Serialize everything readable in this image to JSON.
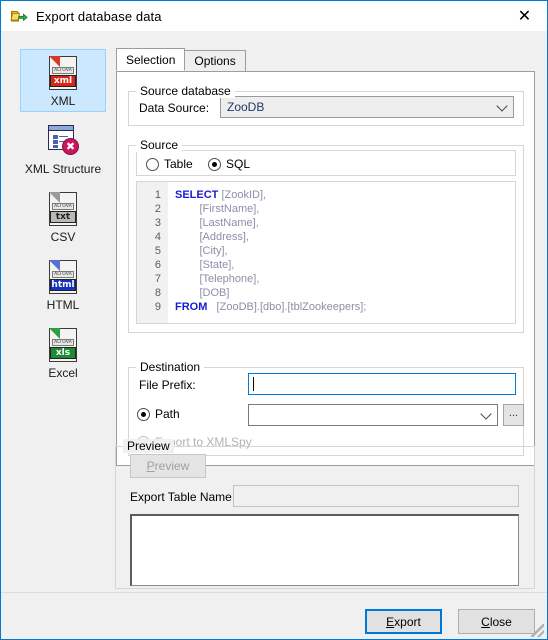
{
  "window": {
    "title": "Export database data",
    "icon": "export-database-icon",
    "close_label": "✕",
    "accent": "#0078d7"
  },
  "sidebar": {
    "items": [
      {
        "label": "XML",
        "icon": "xml-file-icon",
        "badge": "xml",
        "selected": true
      },
      {
        "label": "XML Structure",
        "icon": "xml-structure-icon",
        "badge": "",
        "selected": false
      },
      {
        "label": "CSV",
        "icon": "txt-file-icon",
        "badge": "txt",
        "selected": false
      },
      {
        "label": "HTML",
        "icon": "html-file-icon",
        "badge": "html",
        "selected": false
      },
      {
        "label": "Excel",
        "icon": "xls-file-icon",
        "badge": "xls",
        "selected": false
      }
    ],
    "brand_mark": "ALTOVA"
  },
  "tabs": [
    {
      "label": "Selection",
      "active": true
    },
    {
      "label": "Options",
      "active": false
    }
  ],
  "source_database": {
    "title": "Source database",
    "data_source_label": "Data Source:",
    "data_source_value": "ZooDB",
    "value_color": "#1f3864"
  },
  "source": {
    "title": "Source",
    "options": [
      {
        "label": "Table",
        "selected": false
      },
      {
        "label": "SQL",
        "selected": true
      }
    ],
    "sql": {
      "lines": [
        {
          "n": "1",
          "kw": "SELECT",
          "rest": " [ZookID],"
        },
        {
          "n": "2",
          "kw": "",
          "rest": "        [FirstName],"
        },
        {
          "n": "3",
          "kw": "",
          "rest": "        [LastName],"
        },
        {
          "n": "4",
          "kw": "",
          "rest": "        [Address],"
        },
        {
          "n": "5",
          "kw": "",
          "rest": "        [City],"
        },
        {
          "n": "6",
          "kw": "",
          "rest": "        [State],"
        },
        {
          "n": "7",
          "kw": "",
          "rest": "        [Telephone],"
        },
        {
          "n": "8",
          "kw": "",
          "rest": "        [DOB]"
        },
        {
          "n": "9",
          "kw": "FROM",
          "rest": "   [ZooDB].[dbo].[tblZookeepers];"
        }
      ],
      "keyword_color": "#1b1bd0",
      "identifier_color": "#8e8ea8"
    }
  },
  "destination": {
    "title": "Destination",
    "file_prefix_label": "File Prefix:",
    "file_prefix_value": "",
    "path_label": "Path",
    "path_selected": true,
    "path_value": "",
    "browse_label": "...",
    "xmlspy_label": "Export to XMLSpy",
    "xmlspy_selected": false,
    "xmlspy_disabled": true
  },
  "preview": {
    "title": "Preview",
    "button_label": "Preview",
    "button_accel": "P",
    "button_disabled": true,
    "table_name_label": "Export Table Name:",
    "table_name_value": "",
    "list_rows": []
  },
  "footer": {
    "export_label": "Export",
    "export_accel": "E",
    "export_is_default": true,
    "close_label": "Close",
    "close_accel": "C"
  }
}
